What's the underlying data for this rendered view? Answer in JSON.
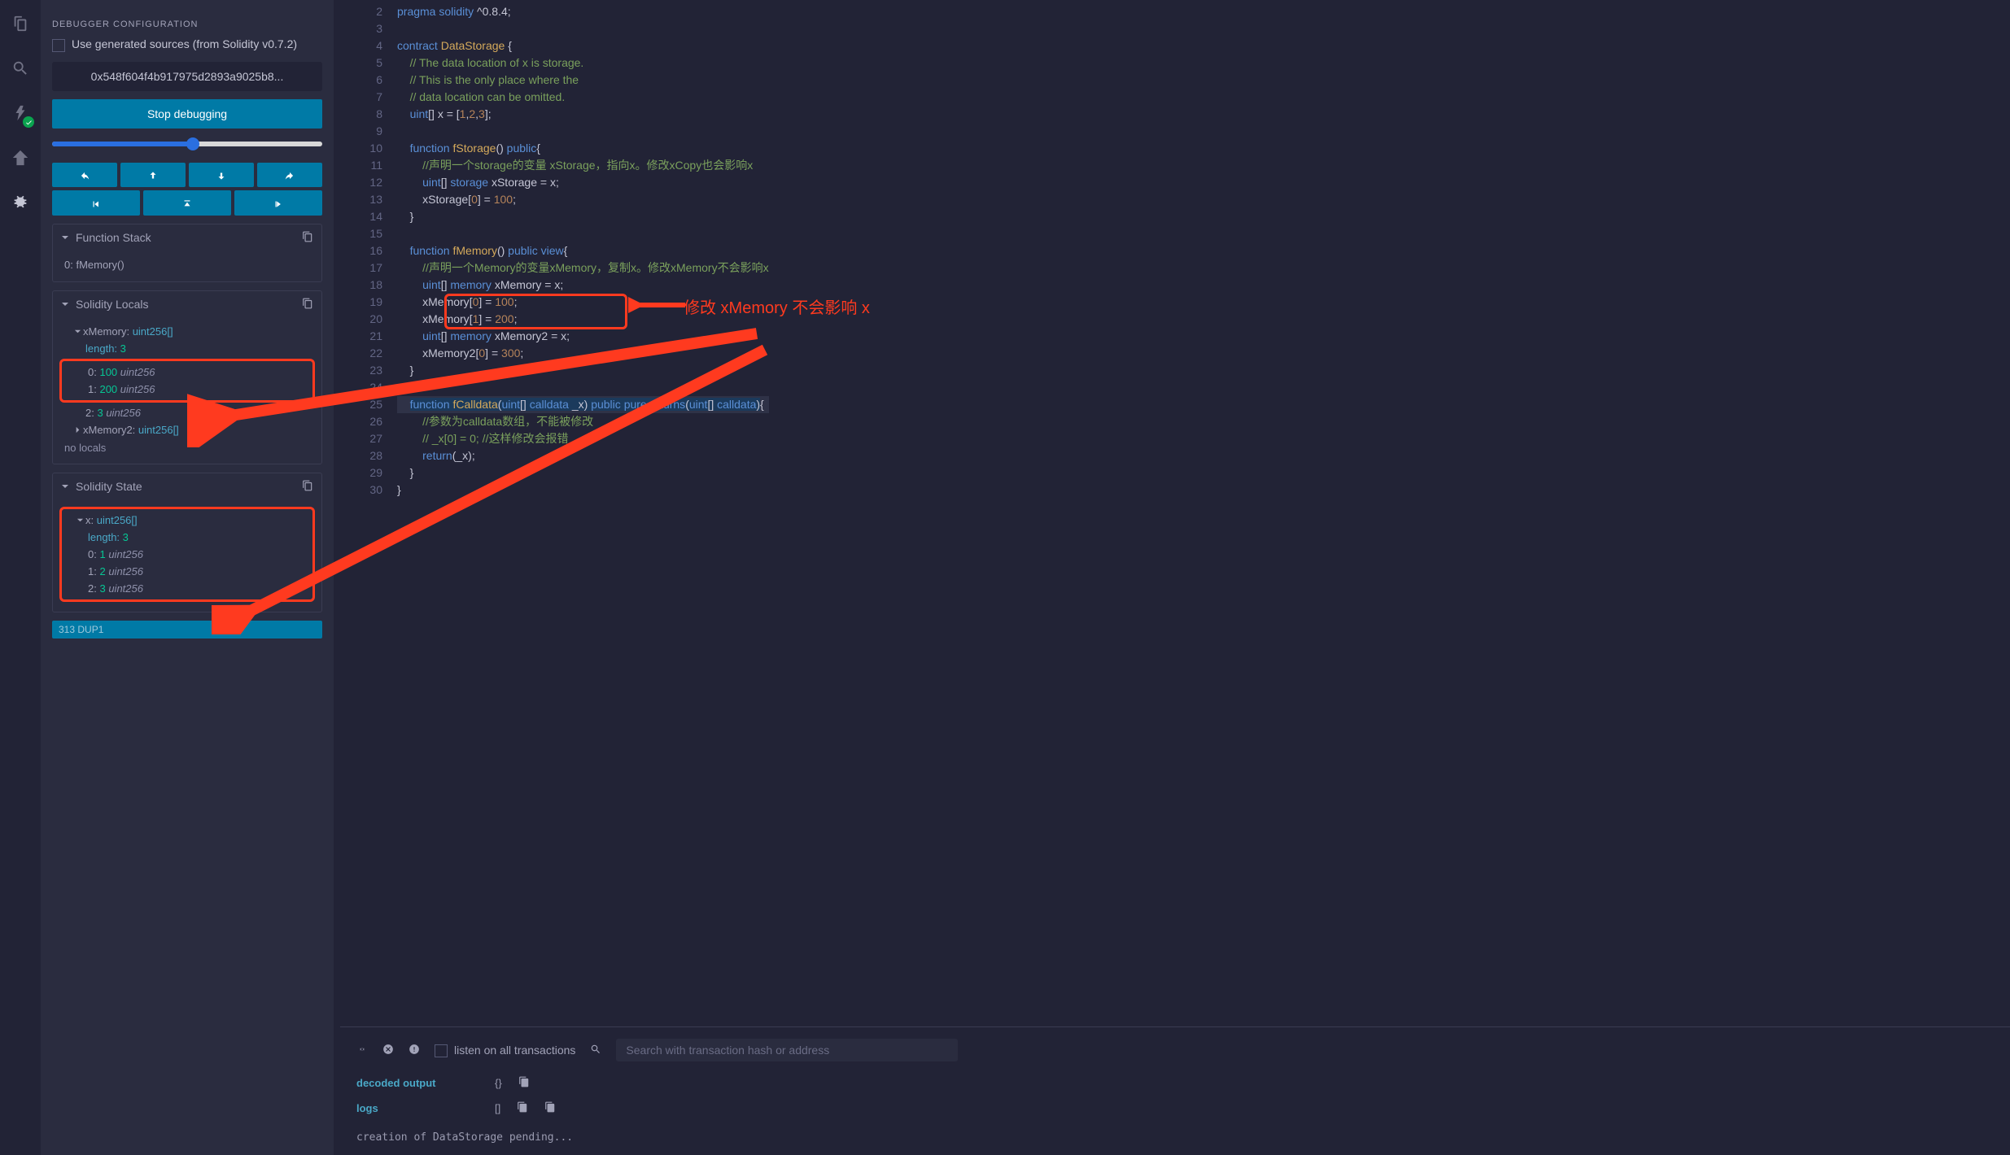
{
  "sidebar": {
    "config_title": "DEBUGGER CONFIGURATION",
    "checkbox_label": "Use generated sources (from Solidity v0.7.2)",
    "address": "0x548f604f4b917975d2893a9025b8...",
    "stop_btn": "Stop debugging",
    "panels": {
      "function_stack": {
        "title": "Function Stack",
        "item": "0: fMemory()"
      },
      "solidity_locals": {
        "title": "Solidity Locals",
        "xmemory_label": "xMemory:",
        "xmemory_type": "uint256[]",
        "length_label": "length:",
        "length_val": "3",
        "row0_idx": "0:",
        "row0_val": "100",
        "row0_type": "uint256",
        "row1_idx": "1:",
        "row1_val": "200",
        "row1_type": "uint256",
        "row2_idx": "2:",
        "row2_val": "3",
        "row2_type": "uint256",
        "xmemory2_label": "xMemory2:",
        "xmemory2_type": "uint256[]",
        "no_locals": "no locals"
      },
      "solidity_state": {
        "title": "Solidity State",
        "x_label": "x:",
        "x_type": "uint256[]",
        "length_label": "length:",
        "length_val": "3",
        "row0_idx": "0:",
        "row0_val": "1",
        "row0_type": "uint256",
        "row1_idx": "1:",
        "row1_val": "2",
        "row1_type": "uint256",
        "row2_idx": "2:",
        "row2_val": "3",
        "row2_type": "uint256"
      },
      "next": "313 DUP1"
    }
  },
  "editor": {
    "lines": [
      {
        "n": 2,
        "html": "<span class='kw'>pragma</span> <span class='kw'>solidity</span> <span class='id'>^0.8.4</span><span class='pl'>;</span>"
      },
      {
        "n": 3,
        "html": ""
      },
      {
        "n": 4,
        "html": "<span class='kw'>contract</span> <span class='fn'>DataStorage</span> <span class='pl'>{</span>"
      },
      {
        "n": 5,
        "html": "    <span class='cmt'>// The data location of x is storage.</span>"
      },
      {
        "n": 6,
        "html": "    <span class='cmt'>// This is the only place where the</span>"
      },
      {
        "n": 7,
        "html": "    <span class='cmt'>// data location can be omitted.</span>"
      },
      {
        "n": 8,
        "html": "    <span class='kw'>uint</span><span class='pl'>[]</span> <span class='id'>x</span> <span class='pl'>= [</span><span class='num'>1</span><span class='pl'>,</span><span class='num'>2</span><span class='pl'>,</span><span class='num'>3</span><span class='pl'>];</span>"
      },
      {
        "n": 9,
        "html": ""
      },
      {
        "n": 10,
        "html": "    <span class='kw'>function</span> <span class='fn'>fStorage</span><span class='pl'>()</span> <span class='kw'>public</span><span class='pl'>{</span>"
      },
      {
        "n": 11,
        "html": "        <span class='cmt'>//声明一个storage的变量 xStorage，指向x。修改xCopy也会影响x</span>"
      },
      {
        "n": 12,
        "html": "        <span class='kw'>uint</span><span class='pl'>[]</span> <span class='kw'>storage</span> <span class='id'>xStorage</span> <span class='pl'>=</span> <span class='id'>x</span><span class='pl'>;</span>"
      },
      {
        "n": 13,
        "html": "        <span class='id'>xStorage</span><span class='pl'>[</span><span class='num'>0</span><span class='pl'>] =</span> <span class='num'>100</span><span class='pl'>;</span>"
      },
      {
        "n": 14,
        "html": "    <span class='pl'>}</span>"
      },
      {
        "n": 15,
        "html": ""
      },
      {
        "n": 16,
        "html": "    <span class='kw'>function</span> <span class='fn'>fMemory</span><span class='pl'>()</span> <span class='kw'>public</span> <span class='kw'>view</span><span class='pl'>{</span>"
      },
      {
        "n": 17,
        "html": "        <span class='cmt'>//声明一个Memory的变量xMemory，复制x。修改xMemory不会影响x</span>"
      },
      {
        "n": 18,
        "html": "        <span class='kw'>uint</span><span class='pl'>[]</span> <span class='kw'>memory</span> <span class='id'>xMemory</span> <span class='pl'>=</span> <span class='id'>x</span><span class='pl'>;</span>"
      },
      {
        "n": 19,
        "html": "        <span class='id'>xMemory</span><span class='pl'>[</span><span class='num'>0</span><span class='pl'>] =</span> <span class='num'>100</span><span class='pl'>;</span>"
      },
      {
        "n": 20,
        "html": "        <span class='id'>xMemory</span><span class='pl'>[</span><span class='num'>1</span><span class='pl'>] =</span> <span class='num'>200</span><span class='pl'>;</span>"
      },
      {
        "n": 21,
        "html": "        <span class='kw'>uint</span><span class='pl'>[]</span> <span class='kw'>memory</span> <span class='id'>xMemory2</span> <span class='pl'>=</span> <span class='id'>x</span><span class='pl'>;</span>",
        "bp": true
      },
      {
        "n": 22,
        "html": "        <span class='id'>xMemory2</span><span class='pl'>[</span><span class='num'>0</span><span class='pl'>] =</span> <span class='num'>300</span><span class='pl'>;</span>"
      },
      {
        "n": 23,
        "html": "    <span class='pl'>}</span>"
      },
      {
        "n": 24,
        "html": "",
        "bp": true
      },
      {
        "n": 25,
        "html": "    <span class='sel-bg'><span class='kw'>function</span> <span class='fn'>fCalldata</span><span class='pl'>(</span><span class='kw'>uint</span><span class='pl'>[]</span> <span class='kw'>calldata</span> <span class='id'>_x</span><span class='pl'>)</span> <span class='kw'>public</span> <span class='kw'>pure</span> <span class='kw'>returns</span><span class='pl'>(</span><span class='kw'>uint</span><span class='pl'>[]</span> <span class='kw'>calldata</span><span class='pl'>)</span></span><span class='pl'>{</span>",
        "cur": true
      },
      {
        "n": 26,
        "html": "        <span class='cmt'>//参数为calldata数组，不能被修改</span>"
      },
      {
        "n": 27,
        "html": "        <span class='cmt'>// _x[0] = 0; //这样修改会报错</span>"
      },
      {
        "n": 28,
        "html": "        <span class='kw'>return</span><span class='pl'>(</span><span class='id'>_x</span><span class='pl'>);</span>"
      },
      {
        "n": 29,
        "html": "    <span class='pl'>}</span>"
      },
      {
        "n": 30,
        "html": "<span class='pl'>}</span>"
      }
    ],
    "annotation": "修改 xMemory 不会影响 x"
  },
  "terminal": {
    "listen_label": "listen on all transactions",
    "search_placeholder": "Search with transaction hash or address",
    "decoded_label": "decoded output",
    "decoded_val": "{}",
    "logs_label": "logs",
    "logs_val": "[]",
    "msg": "creation of DataStorage pending..."
  }
}
